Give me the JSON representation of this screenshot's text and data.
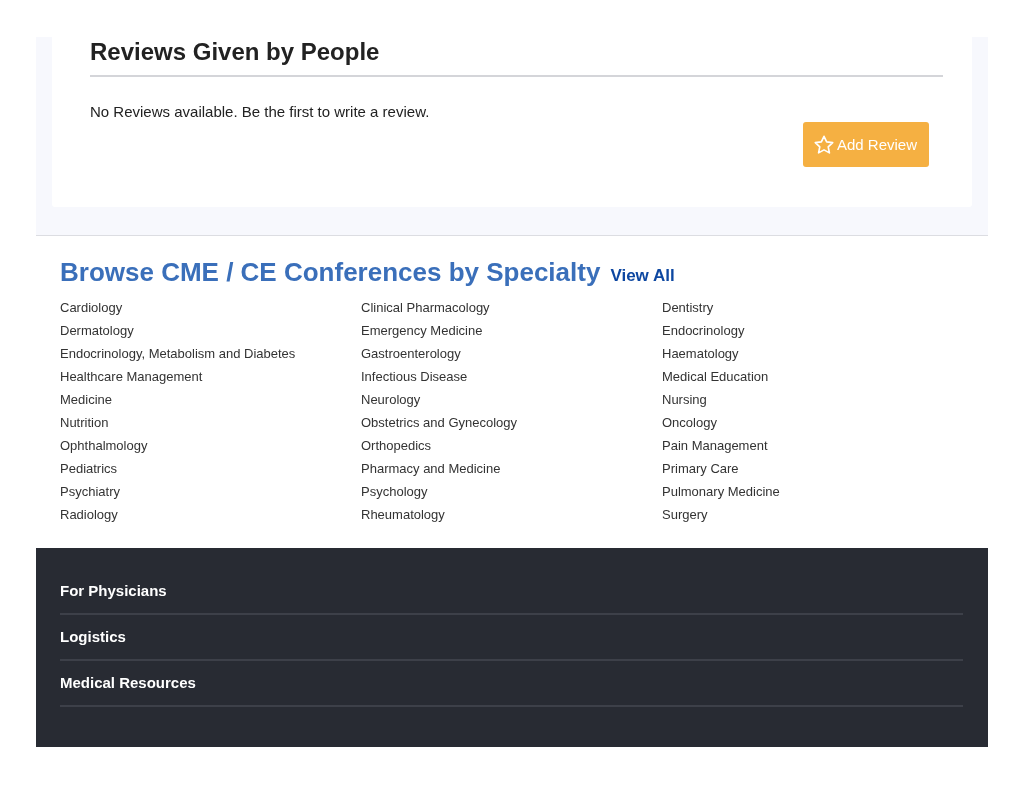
{
  "reviews": {
    "title": "Reviews Given by People",
    "message": "No Reviews available. Be the first to write a review.",
    "button": "Add Review"
  },
  "specialties": {
    "title": "Browse CME / CE Conferences by Specialty",
    "view_all": "View All",
    "items": [
      "Cardiology",
      "Clinical Pharmacology",
      "Dentistry",
      "Dermatology",
      "Emergency Medicine",
      "Endocrinology",
      "Endocrinology, Metabolism and Diabetes",
      "Gastroenterology",
      "Haematology",
      "Healthcare Management",
      "Infectious Disease",
      "Medical Education",
      "Medicine",
      "Neurology",
      "Nursing",
      "Nutrition",
      "Obstetrics and Gynecology",
      "Oncology",
      "Ophthalmology",
      "Orthopedics",
      "Pain Management",
      "Pediatrics",
      "Pharmacy and Medicine",
      "Primary Care",
      "Psychiatry",
      "Psychology",
      "Pulmonary Medicine",
      "Radiology",
      "Rheumatology",
      "Surgery"
    ]
  },
  "footer": {
    "sections": [
      "For Physicians",
      "Logistics",
      "Medical Resources"
    ]
  }
}
